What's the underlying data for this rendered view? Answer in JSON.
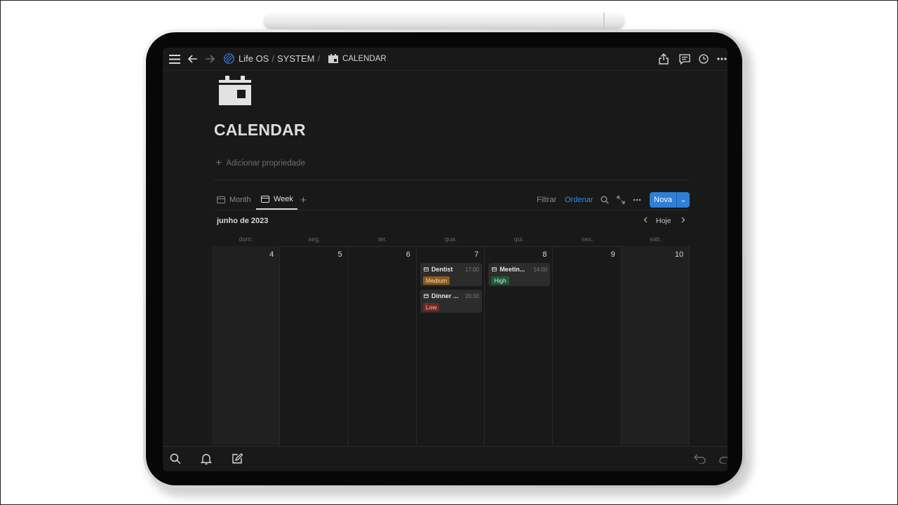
{
  "topbar": {
    "breadcrumb": {
      "workspace": "Life OS",
      "parent": "SYSTEM",
      "separator": "/",
      "current": "CALENDAR"
    }
  },
  "page": {
    "title": "CALENDAR",
    "add_property": "Adicionar propriedade"
  },
  "views": {
    "tabs": [
      {
        "label": "Month",
        "active": false
      },
      {
        "label": "Week",
        "active": true
      }
    ],
    "filter_label": "Filtrar",
    "sort_label": "Ordenar",
    "new_label": "Nova"
  },
  "calendar": {
    "month_label": "junho de 2023",
    "today_label": "Hoje",
    "weekdays": [
      "dom.",
      "seg.",
      "ter.",
      "qua.",
      "qui.",
      "sex.",
      "sáb."
    ],
    "days": [
      {
        "num": "4",
        "weekend": true,
        "events": []
      },
      {
        "num": "5",
        "weekend": false,
        "events": []
      },
      {
        "num": "6",
        "weekend": false,
        "events": []
      },
      {
        "num": "7",
        "weekend": false,
        "events": [
          {
            "title": "Dentist",
            "time": "17:00",
            "priority": "Medium"
          },
          {
            "title": "Dinner ...",
            "time": "20:30",
            "priority": "Low"
          }
        ]
      },
      {
        "num": "8",
        "weekend": false,
        "events": [
          {
            "title": "Meetin...",
            "time": "14:00",
            "priority": "High"
          }
        ]
      },
      {
        "num": "9",
        "weekend": false,
        "events": []
      },
      {
        "num": "10",
        "weekend": true,
        "events": []
      }
    ]
  },
  "colors": {
    "accent": "#2f7fd8",
    "background": "#191919",
    "badge_medium_bg": "#8a5a1e",
    "badge_medium_fg": "#f3d9a8",
    "badge_low_bg": "#6e2a25",
    "badge_low_fg": "#f2c4bd",
    "badge_high_bg": "#1f5a3a",
    "badge_high_fg": "#bfe9cf"
  },
  "icons": {
    "menu": "hamburger-icon",
    "back": "arrow-left-icon",
    "forward": "arrow-right-icon",
    "workspace": "striped-circle-icon",
    "page": "calendar-icon",
    "share": "share-icon",
    "comments": "comment-icon",
    "history": "clock-icon",
    "more": "more-icon",
    "search": "search-icon",
    "notifications": "bell-icon",
    "compose": "compose-icon",
    "undo": "undo-icon",
    "redo": "redo-icon"
  }
}
